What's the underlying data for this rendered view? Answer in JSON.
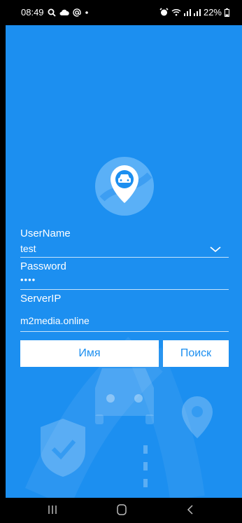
{
  "status_bar": {
    "time": "08:49",
    "battery": "22%",
    "icons_left": [
      "search-icon",
      "cloud-icon",
      "at-icon",
      "dot-icon"
    ],
    "icons_right": [
      "alarm-icon",
      "wifi-icon",
      "signal-icon",
      "signal-icon",
      "battery-icon"
    ]
  },
  "login": {
    "username_label": "UserName",
    "username_value": "test",
    "password_label": "Password",
    "password_value": "••••",
    "server_label": "ServerIP",
    "server_value": "m2media.online"
  },
  "buttons": {
    "name_label": "Имя",
    "search_label": "Поиск"
  },
  "colors": {
    "primary": "#1c8ff0",
    "button_bg": "#ffffff"
  },
  "nav_bar": {
    "icons": [
      "recent-apps-icon",
      "home-icon",
      "back-icon"
    ]
  }
}
